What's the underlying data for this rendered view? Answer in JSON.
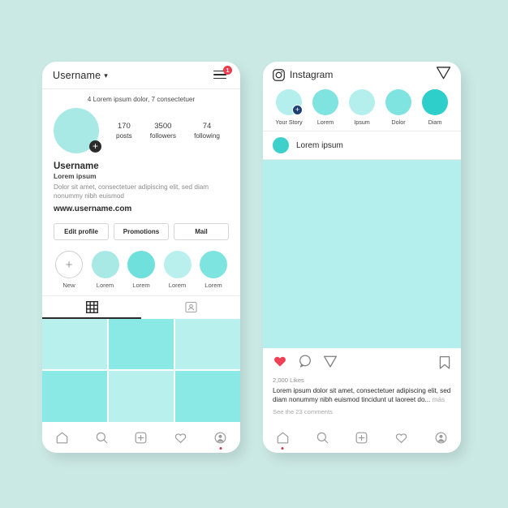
{
  "theme": {
    "background": "#cbe9e4",
    "accent_teal": "#3ed0cb",
    "badge_red": "#ee3b4e",
    "heart_red": "#ef4056",
    "dark": "#2b2b2b"
  },
  "profile_screen": {
    "topbar": {
      "title": "Username",
      "chevron": "⌄",
      "menu_icon": "hamburger-menu-icon",
      "notification_count": "1"
    },
    "subtitle": "4 Lorem ipsum dolor, 7 consectetuer",
    "avatar": {
      "add_label": "+",
      "color": "#a8e9e6"
    },
    "stats": [
      {
        "number": "170",
        "label": "posts"
      },
      {
        "number": "3500",
        "label": "followers"
      },
      {
        "number": "74",
        "label": "following"
      }
    ],
    "bio": {
      "name": "Username",
      "subtitle": "Lorem ipsum",
      "text": "Dolor sit amet, consectetuer adipiscing elit, sed diam nonummy nibh euismod",
      "link": "www.username.com"
    },
    "actions": [
      {
        "label": "Edit profile"
      },
      {
        "label": "Promotions"
      },
      {
        "label": "Mail"
      }
    ],
    "highlights": [
      {
        "label": "New",
        "type": "new",
        "glyph": "+",
        "color": "#ffffff"
      },
      {
        "label": "Lorem",
        "type": "story",
        "color": "#a8e9e6"
      },
      {
        "label": "Lorem",
        "type": "story",
        "color": "#6fe0dc"
      },
      {
        "label": "Lorem",
        "type": "story",
        "color": "#b9efed"
      },
      {
        "label": "Lorem",
        "type": "story",
        "color": "#7ee4e0"
      }
    ],
    "tabs": [
      {
        "icon": "grid-icon",
        "active": true
      },
      {
        "icon": "tagged-person-icon",
        "active": false
      }
    ],
    "grid_tiles": [
      "#b8f0ee",
      "#8ae8e5",
      "#b8f0ee",
      "#8ae8e5",
      "#b8f0ee",
      "#8ae8e5"
    ],
    "bottom_nav": [
      {
        "icon": "home-icon",
        "active": false
      },
      {
        "icon": "search-icon",
        "active": false
      },
      {
        "icon": "add-post-icon",
        "active": false
      },
      {
        "icon": "heart-icon",
        "active": false
      },
      {
        "icon": "profile-icon",
        "active": true
      }
    ]
  },
  "feed_screen": {
    "header": {
      "brand": "Instagram",
      "brand_icon": "camera-icon",
      "share_icon": "direct-message-icon"
    },
    "stories": [
      {
        "label": "Your Story",
        "color": "#b4efed",
        "has_add": true,
        "add_glyph": "+"
      },
      {
        "label": "Lorem",
        "color": "#7fe3df",
        "has_add": false
      },
      {
        "label": "Ipsum",
        "color": "#b4efed",
        "has_add": false
      },
      {
        "label": "Dolor",
        "color": "#7fe3df",
        "has_add": false
      },
      {
        "label": "Diam",
        "color": "#2ecfca",
        "has_add": false
      }
    ],
    "post": {
      "username": "Lorem ipsum",
      "avatar_color": "#3ed0cb",
      "image_color": "#b4efed",
      "actions": [
        {
          "icon": "heart-filled-icon"
        },
        {
          "icon": "comment-icon"
        },
        {
          "icon": "share-icon"
        }
      ],
      "save_icon": "bookmark-icon",
      "likes": "2,000 Likes",
      "caption": "Lorem ipsum dolor sit amet, consectetuer adipiscing elit, sed diam nonummy nibh euismod tincidunt ut laoreet do...",
      "more_label": "más",
      "comments": "See the 23 comments"
    },
    "bottom_nav": [
      {
        "icon": "home-icon",
        "active": true
      },
      {
        "icon": "search-icon",
        "active": false
      },
      {
        "icon": "add-post-icon",
        "active": false
      },
      {
        "icon": "heart-icon",
        "active": false
      },
      {
        "icon": "profile-icon",
        "active": false
      }
    ]
  }
}
